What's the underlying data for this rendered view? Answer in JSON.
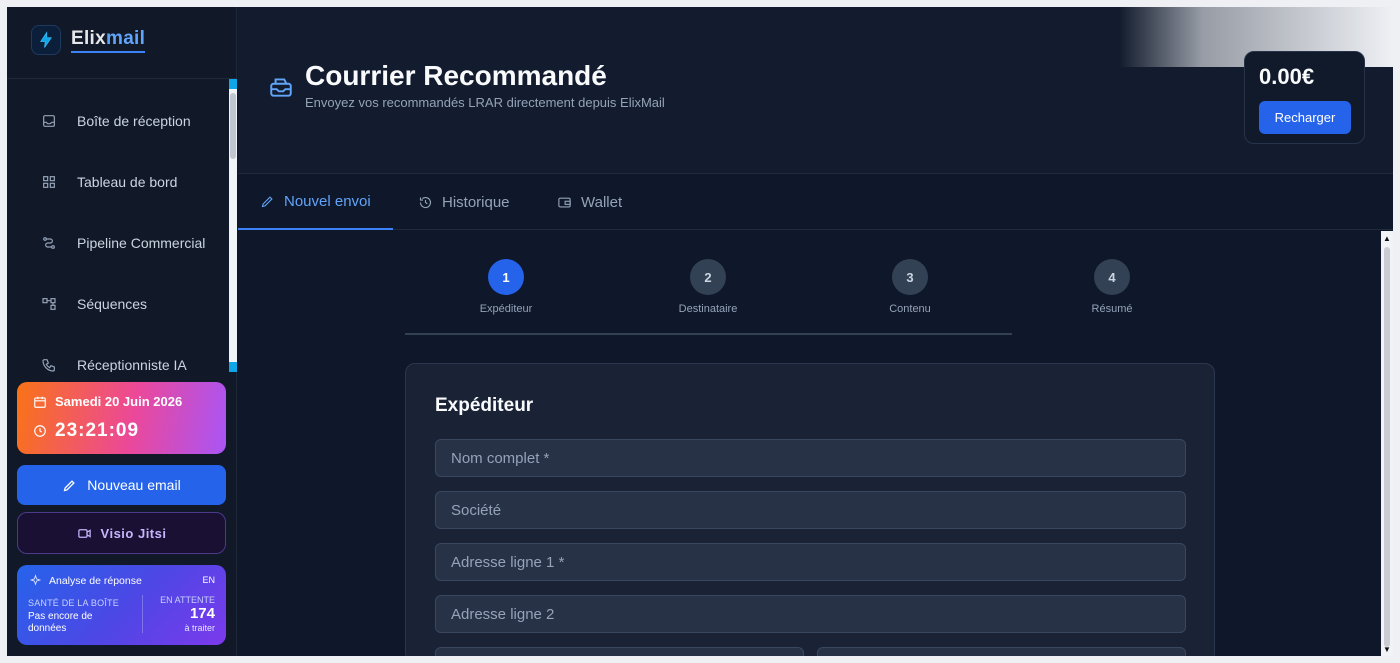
{
  "app": {
    "logo_part1": "Elix",
    "logo_part2": "mail"
  },
  "sidebar": {
    "items": [
      {
        "label": "Boîte de réception",
        "icon": "inbox-icon"
      },
      {
        "label": "Tableau de bord",
        "icon": "dashboard-icon"
      },
      {
        "label": "Pipeline Commercial",
        "icon": "pipeline-icon"
      },
      {
        "label": "Séquences",
        "icon": "sequences-icon"
      },
      {
        "label": "Réceptionniste IA",
        "icon": "phone-icon"
      }
    ],
    "date": "Samedi 20 Juin 2026",
    "time": "23:21:09",
    "new_email": "Nouveau email",
    "visio": "Visio Jitsi",
    "analysis": {
      "title": "Analyse de réponse",
      "lang": "EN",
      "health_label": "SANTÉ DE LA BOÎTE",
      "health_value": "Pas encore de données",
      "pending_label": "EN ATTENTE",
      "pending_count": "174",
      "pending_sub": "à traiter"
    }
  },
  "header": {
    "title": "Courrier Recommandé",
    "subtitle": "Envoyez vos recommandés LRAR directement depuis ElixMail",
    "balance": "0.00€",
    "recharge": "Recharger"
  },
  "tabs": [
    {
      "label": "Nouvel envoi",
      "icon": "pencil-icon",
      "active": true
    },
    {
      "label": "Historique",
      "icon": "history-icon",
      "active": false
    },
    {
      "label": "Wallet",
      "icon": "wallet-icon",
      "active": false
    }
  ],
  "steps": [
    {
      "num": "1",
      "label": "Expéditeur",
      "active": true
    },
    {
      "num": "2",
      "label": "Destinataire",
      "active": false
    },
    {
      "num": "3",
      "label": "Contenu",
      "active": false
    },
    {
      "num": "4",
      "label": "Résumé",
      "active": false
    }
  ],
  "form": {
    "title": "Expéditeur",
    "fields": [
      {
        "placeholder": "Nom complet *"
      },
      {
        "placeholder": "Société"
      },
      {
        "placeholder": "Adresse ligne 1 *"
      },
      {
        "placeholder": "Adresse ligne 2"
      }
    ]
  },
  "colors": {
    "accent": "#2563eb",
    "bg": "#0f172a",
    "sidebar": "#111827"
  }
}
